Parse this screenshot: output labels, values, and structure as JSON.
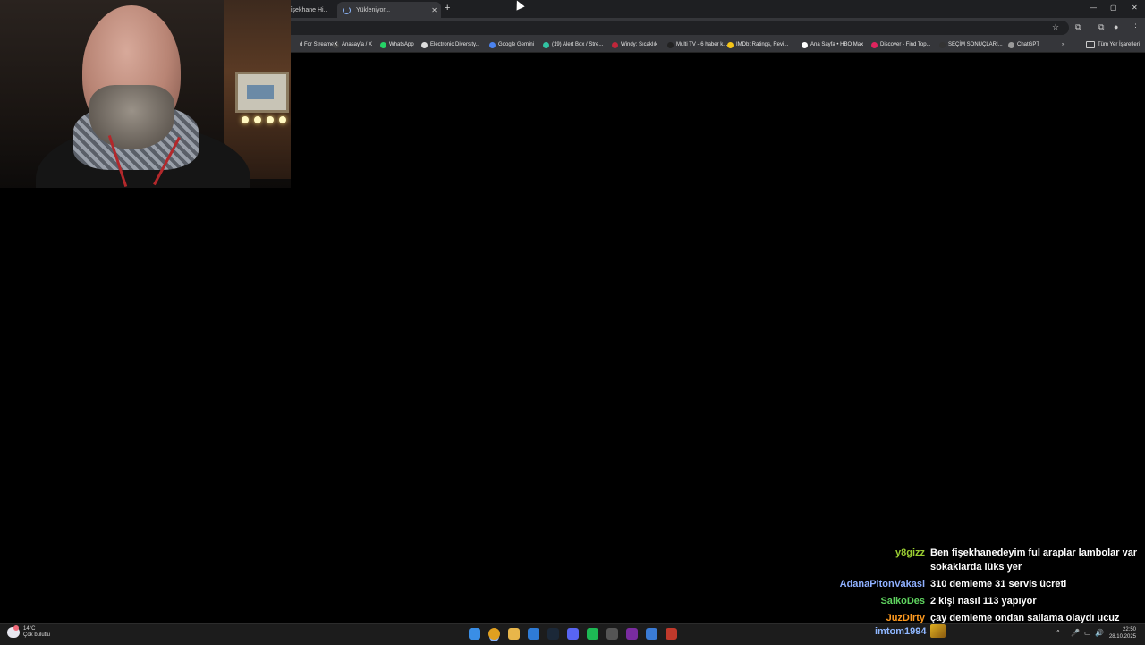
{
  "browser": {
    "tabs": [
      {
        "title": "i̇şekhane Hi..",
        "close": "✕",
        "state": "inactive"
      },
      {
        "title": "Yükleniyor...",
        "close": "✕",
        "state": "active"
      }
    ],
    "new_tab": "+",
    "window_controls": {
      "minimize": "—",
      "maximize": "▢",
      "close": "✕"
    },
    "toolbar_icons": {
      "star": "☆",
      "extensions": "⧉",
      "profile": "●",
      "menu": "⋮"
    },
    "bookmarks": [
      {
        "label": "d For Streamers",
        "icon_color": "#00000000"
      },
      {
        "label": "Anasayfa / X",
        "icon_color": "#444444",
        "icon": "X"
      },
      {
        "label": "WhatsApp",
        "icon_color": "#25d366"
      },
      {
        "label": "Electronic Diversity...",
        "icon_color": "#dddddd"
      },
      {
        "label": "Google Gemini",
        "icon_color": "#4b83f0"
      },
      {
        "label": "(19) Alert Box / Stre...",
        "icon_color": "#31c3a2"
      },
      {
        "label": "Windy: Sıcaklık",
        "icon_color": "#c0263a"
      },
      {
        "label": "Multi TV - 6 haber k...",
        "icon_color": "#222222"
      },
      {
        "label": "IMDb: Ratings, Revi...",
        "icon_color": "#f5c518"
      },
      {
        "label": "Ana Sayfa • HBO Max",
        "icon_color": "#ffffff"
      },
      {
        "label": "Discover - Find Top...",
        "icon_color": "#e0245e"
      },
      {
        "label": "SEÇİM SONUÇLARI...",
        "icon_color": "#333333"
      },
      {
        "label": "ChatGPT",
        "icon_color": "#9a9a9a"
      }
    ],
    "more_bookmarks": "»",
    "all_bookmarks": "Tüm Yer İşaretleri"
  },
  "chat": {
    "messages": [
      {
        "user": "y8gizz",
        "user_color": "#9acd32",
        "text": "Ben fişekhanedeyim ful araplar lambolar var sokaklarda lüks yer"
      },
      {
        "user": "AdanaPitonVakasi",
        "user_color": "#8fb0ff",
        "text": "310 demleme 31 servis ücreti"
      },
      {
        "user": "SaikoDes",
        "user_color": "#5fd35f",
        "text": "2 kişi nasıl 113 yapıyor"
      },
      {
        "user": "JuzDirty",
        "user_color": "#ff9a1f",
        "text": "çay demleme ondan sallama olaydı ucuz olurdu"
      }
    ],
    "bottom_user": "imtom1994"
  },
  "taskbar": {
    "weather": {
      "temp": "14°C",
      "desc": "Çok bulutlu"
    },
    "apps": [
      {
        "name": "start",
        "color": "#3a8ee6"
      },
      {
        "name": "chrome",
        "color": "#e0a020"
      },
      {
        "name": "file-explorer",
        "color": "#e8b64a"
      },
      {
        "name": "app-blue",
        "color": "#2e7bd6"
      },
      {
        "name": "steam",
        "color": "#1b2838"
      },
      {
        "name": "discord",
        "color": "#5865f2"
      },
      {
        "name": "spotify",
        "color": "#1db954"
      },
      {
        "name": "app-grid",
        "color": "#555555"
      },
      {
        "name": "app-next",
        "color": "#7a2ca0"
      },
      {
        "name": "app-blue-2",
        "color": "#3a7bd5"
      },
      {
        "name": "app-red",
        "color": "#c0392b"
      }
    ],
    "tray": {
      "chevron": "^",
      "mic": "🎤",
      "network": "▭",
      "volume": "🔊"
    },
    "time": "22:50",
    "date": "28.10.2025"
  }
}
